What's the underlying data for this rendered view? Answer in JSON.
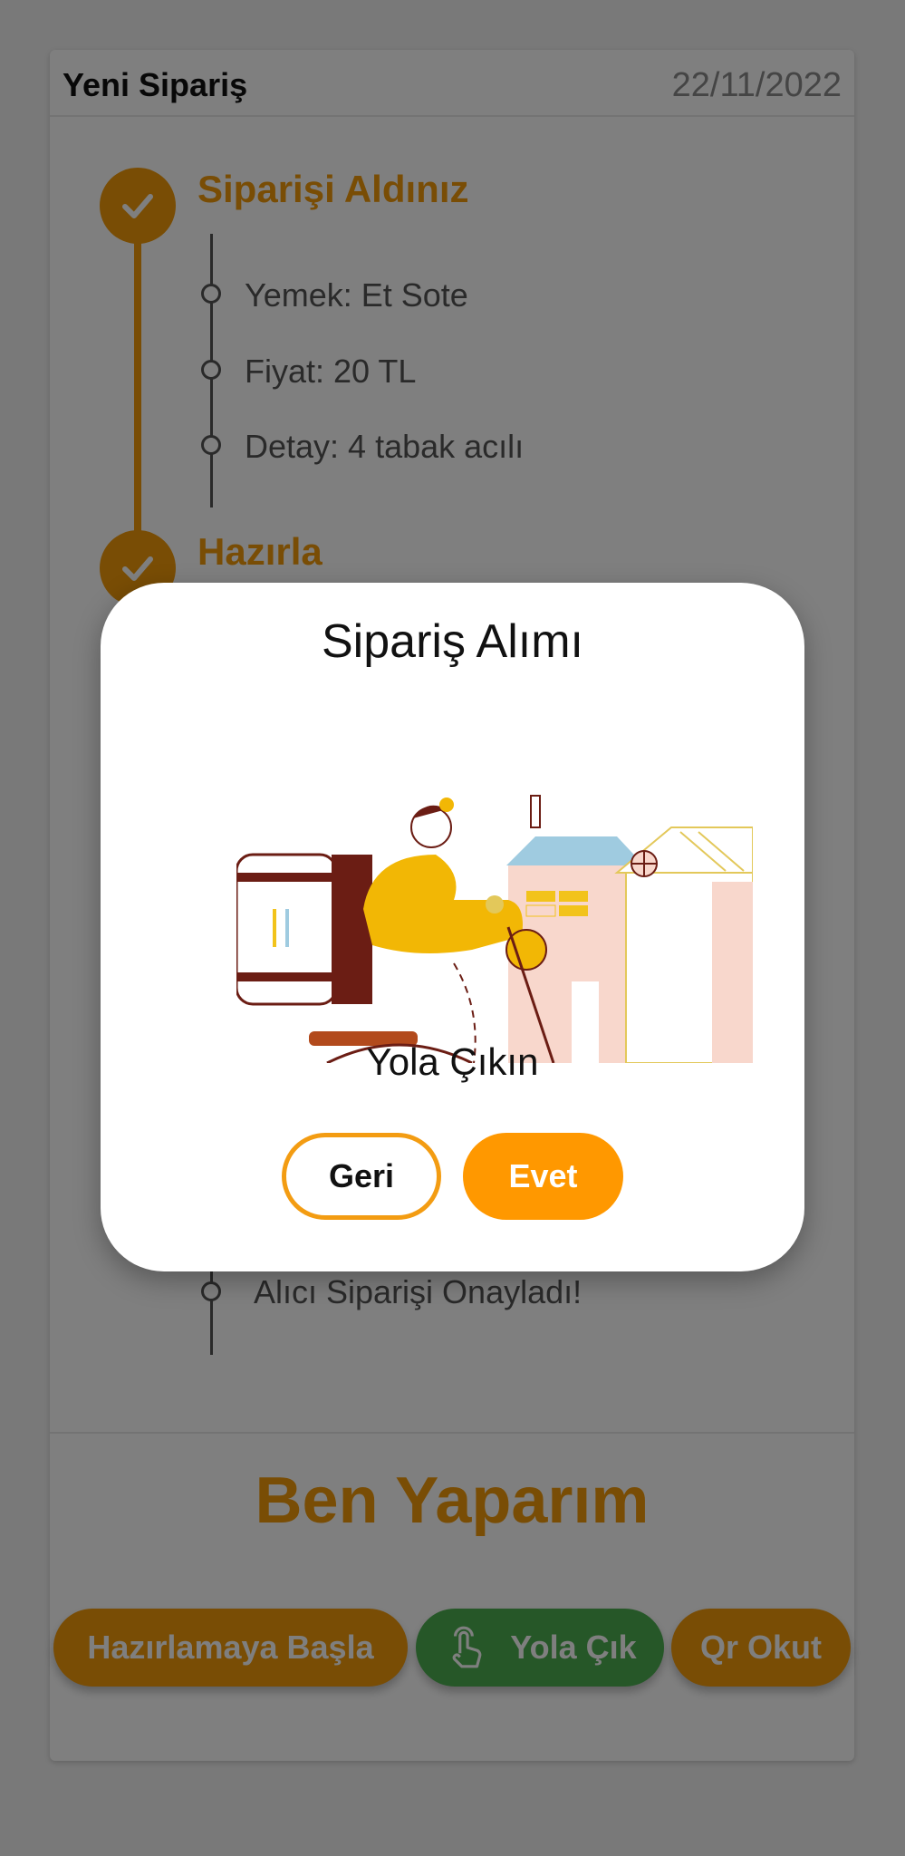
{
  "header": {
    "title": "Yeni Sipariş",
    "date": "22/11/2022"
  },
  "steps": [
    {
      "title": "Siparişi Aldınız",
      "details": [
        "Yemek: Et Sote",
        "Fiyat: 20 TL",
        "Detay: 4 tabak acılı"
      ]
    },
    {
      "title": "Hazırla"
    },
    {
      "detail": "Alıcı Siparişi Onayladı!"
    }
  ],
  "big_title": "Ben Yaparım",
  "actions": {
    "prepare_label": "Hazırlamaya Başla",
    "go_label": "Yola Çık",
    "qr_label": "Qr Okut"
  },
  "dialog": {
    "title": "Sipariş Alımı",
    "message": "Yola Çıkın",
    "back_label": "Geri",
    "yes_label": "Evet"
  },
  "colors": {
    "accent": "#f29a0b",
    "green": "#4caf50",
    "dialog_yes": "#ff9800"
  },
  "icons": [
    "check-icon",
    "touch-hand-icon",
    "delivery-illustration"
  ]
}
